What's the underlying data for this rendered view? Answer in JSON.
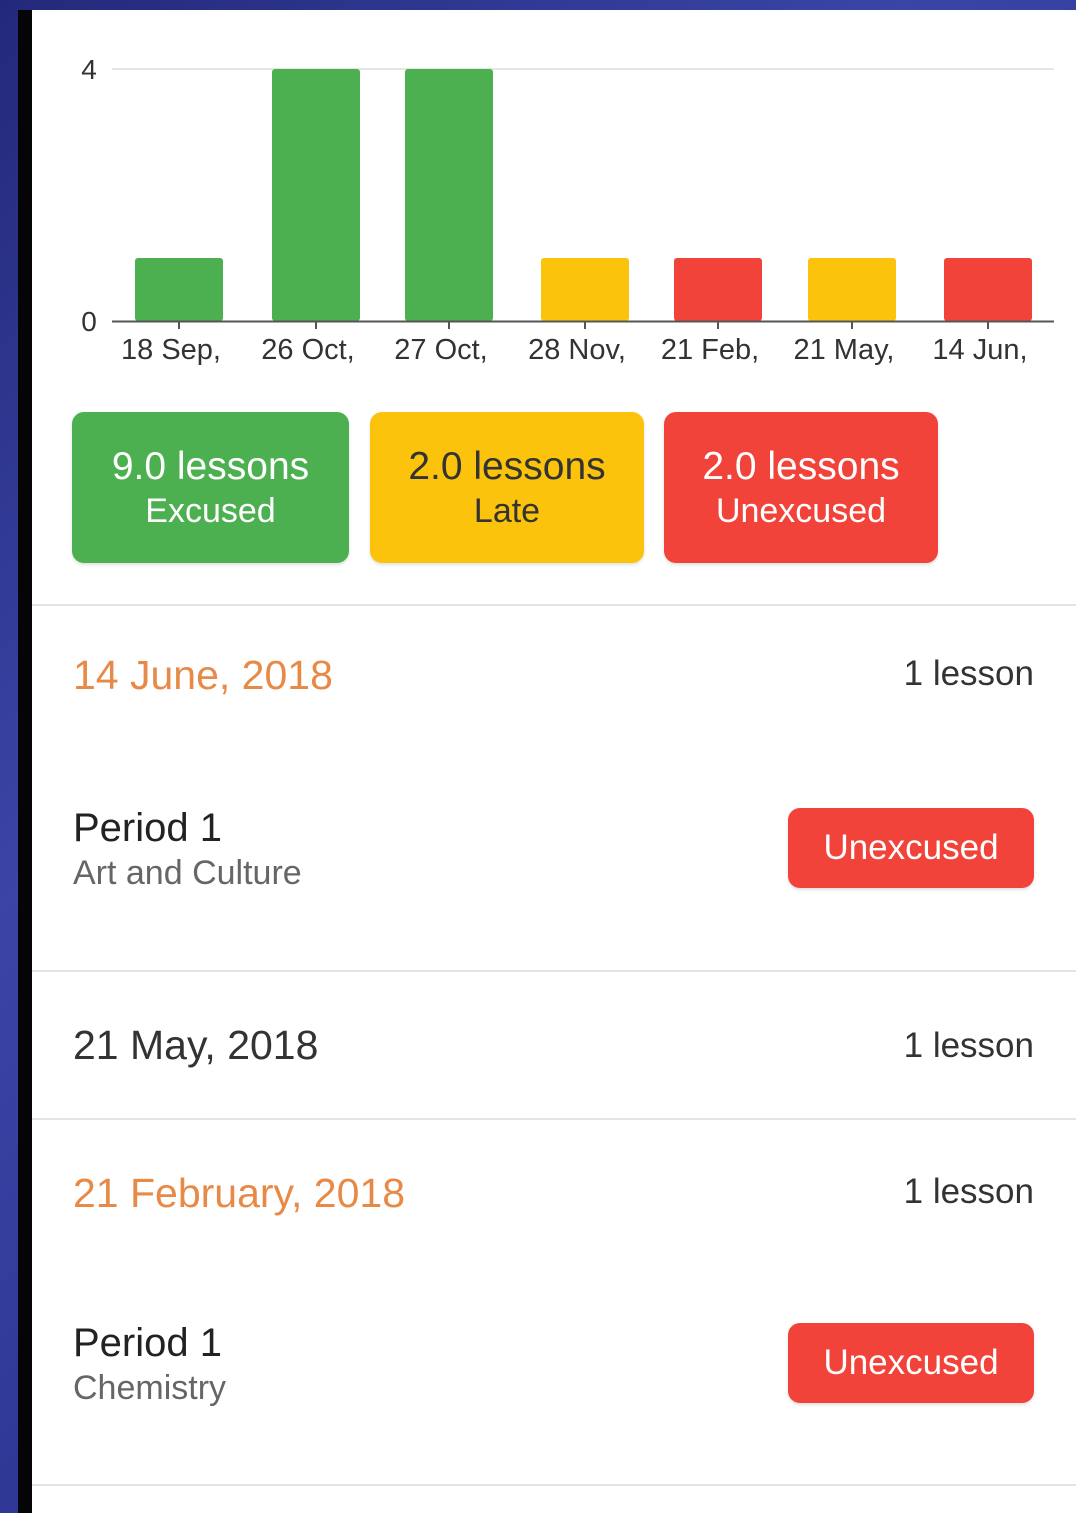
{
  "chart_data": {
    "type": "bar",
    "categories": [
      "18 Sep,",
      "26 Oct,",
      "27 Oct,",
      "28 Nov,",
      "21 Feb,",
      "21 May,",
      "14 Jun,"
    ],
    "values": [
      1,
      4,
      4,
      1,
      1,
      1,
      1
    ],
    "bar_colors": [
      "#4caf50",
      "#4caf50",
      "#4caf50",
      "#fcc30d",
      "#f2433a",
      "#fcc30d",
      "#f2433a"
    ],
    "yticks": [
      "0",
      "4"
    ],
    "ylim": [
      0,
      4
    ],
    "grid": true
  },
  "summary": {
    "excused": {
      "count": "9.0 lessons",
      "label": "Excused",
      "color": "#4caf50"
    },
    "late": {
      "count": "2.0 lessons",
      "label": "Late",
      "color": "#fcc30d"
    },
    "unexcused": {
      "count": "2.0 lessons",
      "label": "Unexcused",
      "color": "#f2433a"
    }
  },
  "entries": [
    {
      "date": "14 June, 2018",
      "count": "1 lesson",
      "period": "Period 1",
      "subject": "Art and Culture",
      "status": "Unexcused"
    },
    {
      "date": "21 May, 2018",
      "count": "1 lesson"
    },
    {
      "date": "21 February, 2018",
      "count": "1 lesson",
      "period": "Period 1",
      "subject": "Chemistry",
      "status": "Unexcused"
    }
  ],
  "colors": {
    "date_highlight": "#e88a47",
    "unexcused_badge": "#f2433a"
  }
}
